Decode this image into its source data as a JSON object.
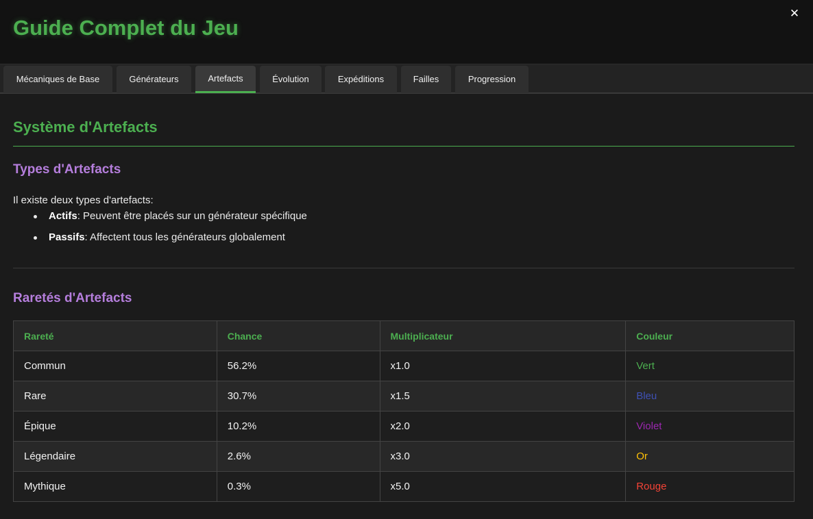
{
  "window": {
    "title": "Guide Complet du Jeu",
    "close_label": "✕"
  },
  "tabs": [
    {
      "label": "Mécaniques de Base",
      "active": false
    },
    {
      "label": "Générateurs",
      "active": false
    },
    {
      "label": "Artefacts",
      "active": true
    },
    {
      "label": "Évolution",
      "active": false
    },
    {
      "label": "Expéditions",
      "active": false
    },
    {
      "label": "Failles",
      "active": false
    },
    {
      "label": "Progression",
      "active": false
    }
  ],
  "section": {
    "title": "Système d'Artefacts",
    "types": {
      "heading": "Types d'Artefacts",
      "intro": "Il existe deux types d'artefacts:",
      "items": [
        {
          "term": "Actifs",
          "desc": ": Peuvent être placés sur un générateur spécifique"
        },
        {
          "term": "Passifs",
          "desc": ": Affectent tous les générateurs globalement"
        }
      ]
    },
    "rarities": {
      "heading": "Raretés d'Artefacts",
      "columns": [
        "Rareté",
        "Chance",
        "Multiplicateur",
        "Couleur"
      ],
      "rows": [
        {
          "rarity": "Commun",
          "chance": "56.2%",
          "multiplier": "x1.0",
          "color_name": "Vert",
          "color": "#4caf50"
        },
        {
          "rarity": "Rare",
          "chance": "30.7%",
          "multiplier": "x1.5",
          "color_name": "Bleu",
          "color": "#3f51b5"
        },
        {
          "rarity": "Épique",
          "chance": "10.2%",
          "multiplier": "x2.0",
          "color_name": "Violet",
          "color": "#9c27b0"
        },
        {
          "rarity": "Légendaire",
          "chance": "2.6%",
          "multiplier": "x3.0",
          "color_name": "Or",
          "color": "#ffc107"
        },
        {
          "rarity": "Mythique",
          "chance": "0.3%",
          "multiplier": "x5.0",
          "color_name": "Rouge",
          "color": "#f44336"
        }
      ]
    }
  },
  "theme": {
    "accent": "#4caf50",
    "subheading": "#b57edc",
    "background": "#1b1b1b"
  }
}
